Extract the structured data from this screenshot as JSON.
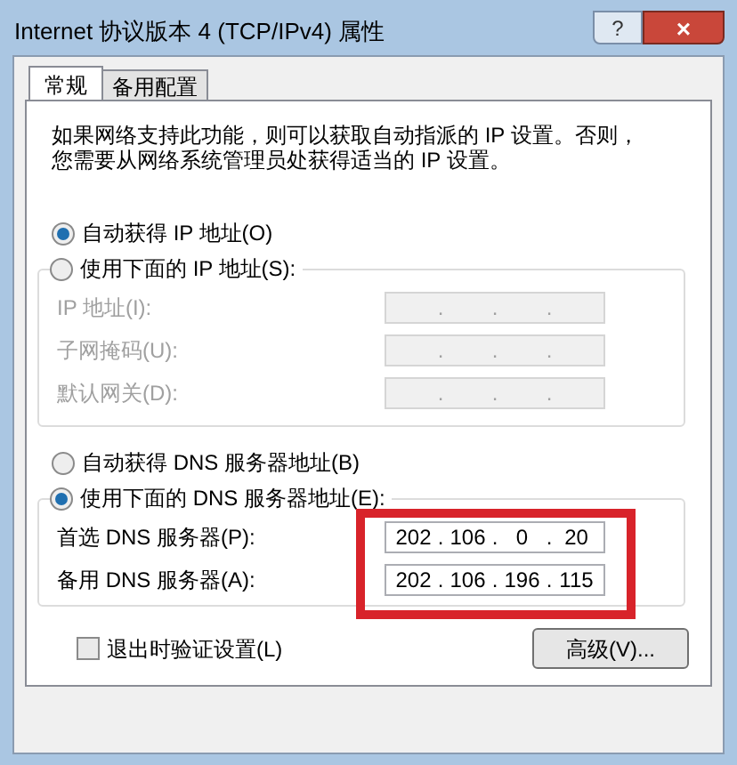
{
  "window": {
    "title": "Internet 协议版本 4 (TCP/IPv4) 属性",
    "help": "?",
    "close": "×"
  },
  "tabs": [
    {
      "label": "常规",
      "selected": true
    },
    {
      "label": "备用配置",
      "selected": false
    }
  ],
  "intro": "如果网络支持此功能，则可以获取自动指派的 IP 设置。否则，您需要从网络系统管理员处获得适当的 IP 设置。",
  "ip_mode": [
    {
      "label": "自动获得 IP 地址(O)",
      "selected": true
    },
    {
      "label": "使用下面的 IP 地址(S):",
      "selected": false
    }
  ],
  "ip_fields": [
    {
      "label": "IP 地址(I):",
      "disabled": true,
      "separator": "."
    },
    {
      "label": "子网掩码(U):",
      "disabled": true,
      "separator": "."
    },
    {
      "label": "默认网关(D):",
      "disabled": true,
      "separator": "."
    }
  ],
  "dns_mode": [
    {
      "label": "自动获得 DNS 服务器地址(B)",
      "selected": false
    },
    {
      "label": "使用下面的 DNS 服务器地址(E):",
      "selected": true
    }
  ],
  "dns_fields": [
    {
      "label": "首选 DNS 服务器(P):",
      "disabled": false,
      "separator": ".",
      "octets": [
        "202",
        "106",
        "0",
        "20"
      ]
    },
    {
      "label": "备用 DNS 服务器(A):",
      "disabled": false,
      "separator": ".",
      "octets": [
        "202",
        "106",
        "196",
        "115"
      ]
    }
  ],
  "validate": {
    "label": "退出时验证设置(L)",
    "checked": false
  },
  "advanced_button": "高级(V)..."
}
